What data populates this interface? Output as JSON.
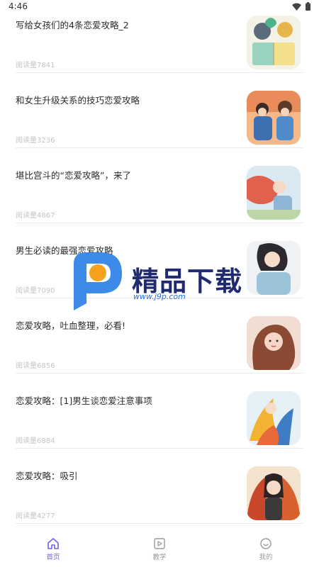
{
  "status_bar": {
    "time": "4:46"
  },
  "articles": [
    {
      "title": "写给女孩们的4条恋爱攻略_2",
      "views": "阅读量7841"
    },
    {
      "title": "和女生升级关系的技巧恋爱攻略",
      "views": "阅读量3236"
    },
    {
      "title": "堪比宫斗的“恋爱攻略”，来了",
      "views": "阅读量4867"
    },
    {
      "title": "男生必读的最强恋爱攻略",
      "views": "阅读量7090"
    },
    {
      "title": "恋爱攻略，吐血整理，必看!",
      "views": "阅读量6856"
    },
    {
      "title": "恋爱攻略：[1]男生谈恋爱注意事项",
      "views": "阅读量6884"
    },
    {
      "title": "恋爱攻略：吸引",
      "views": "阅读量4277"
    }
  ],
  "watermark": {
    "text": "精品下载",
    "url": "www.j9p.com"
  },
  "bottom_nav": [
    {
      "label": "首页",
      "icon": "home-icon",
      "active": true
    },
    {
      "label": "教学",
      "icon": "video-icon",
      "active": false
    },
    {
      "label": "我的",
      "icon": "smile-icon",
      "active": false
    }
  ],
  "colors": {
    "accent": "#6f63e8",
    "views_text": "#c4c4c4",
    "divider": "#ececec"
  }
}
